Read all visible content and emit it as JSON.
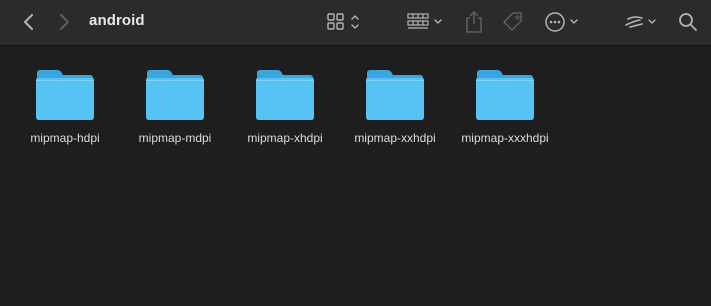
{
  "window": {
    "title": "android"
  },
  "toolbar": {
    "back_icon": "chevron-left-icon",
    "forward_icon": "chevron-right-icon",
    "view_icon": "grid-view-icon",
    "group_icon": "group-by-icon",
    "share_icon": "share-icon",
    "tag_icon": "tag-icon",
    "action_icon": "more-actions-icon",
    "extra_icon": "toolbar-extension-icon",
    "search_icon": "search-icon"
  },
  "folders": [
    {
      "name": "mipmap-hdpi"
    },
    {
      "name": "mipmap-mdpi"
    },
    {
      "name": "mipmap-xhdpi"
    },
    {
      "name": "mipmap-xxhdpi"
    },
    {
      "name": "mipmap-xxxhdpi"
    }
  ],
  "colors": {
    "toolbar_bg": "#2b2b2b",
    "content_bg": "#1e1e1e",
    "folder_front": "#57c3f5",
    "folder_back": "#3aa6de"
  }
}
